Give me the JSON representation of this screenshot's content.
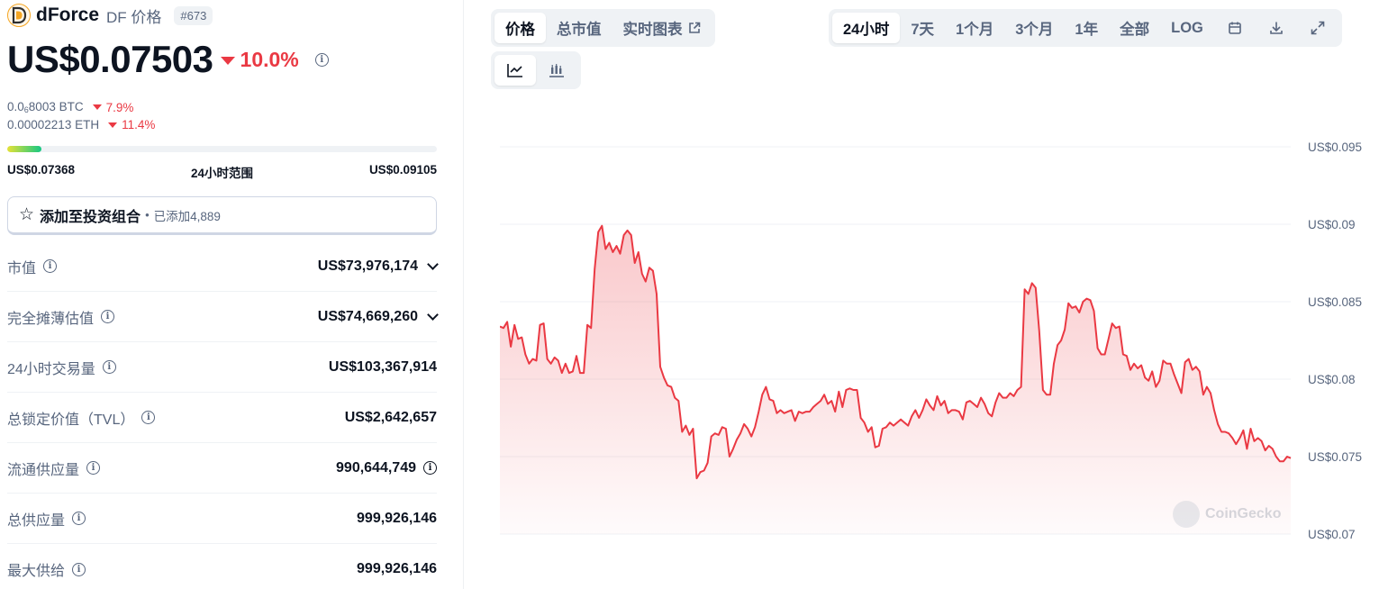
{
  "coin": {
    "name": "dForce",
    "symbol": "DF",
    "price_word": "价格",
    "rank": "#673",
    "price": "US$0.07503",
    "change_pct": "10.0%",
    "btc_price": "8003 BTC",
    "btc_change": "7.9%",
    "eth_price": "0.00002213 ETH",
    "eth_change": "11.4%"
  },
  "range": {
    "low": "US$0.07368",
    "label": "24小时范围",
    "high": "US$0.09105",
    "fill_fraction": 0.08
  },
  "portfolio": {
    "label": "添加至投资组合",
    "added": "已添加4,889"
  },
  "stats": [
    {
      "label": "市值",
      "value": "US$73,976,174",
      "icon": "info-icon",
      "expand": true
    },
    {
      "label": "完全摊薄估值",
      "value": "US$74,669,260",
      "icon": "info-icon",
      "expand": true
    },
    {
      "label": "24小时交易量",
      "value": "US$103,367,914",
      "icon": "info-icon"
    },
    {
      "label": "总锁定价值（TVL）",
      "value": "US$2,642,657",
      "icon": "info-icon"
    },
    {
      "label": "流通供应量",
      "value": "990,644,749",
      "icon": "info-icon",
      "value_info": true
    },
    {
      "label": "总供应量",
      "value": "999,926,146",
      "icon": "info-icon"
    },
    {
      "label": "最大供给",
      "value": "999,926,146",
      "icon": "info-icon"
    }
  ],
  "chart_tabs": {
    "type_tabs": [
      "价格",
      "总市值",
      "实时图表"
    ],
    "active_type": "价格",
    "style_icons": [
      "line-chart-icon",
      "candlestick-icon"
    ],
    "range_tabs": [
      "24小时",
      "7天",
      "1个月",
      "3个月",
      "1年",
      "全部",
      "LOG"
    ],
    "active_range": "24小时",
    "tool_icons": [
      "calendar-icon",
      "download-icon",
      "fullscreen-icon"
    ]
  },
  "watermark": "CoinGecko",
  "colors": {
    "line": "#ea3943",
    "fill": "#ea3943",
    "grid": "#eff2f5",
    "muted": "#58667e"
  },
  "chart_data": {
    "type": "area",
    "title": "",
    "ylim": [
      0.07,
      0.095
    ],
    "yticks": [
      0.095,
      0.09,
      0.085,
      0.08,
      0.075,
      0.07
    ],
    "ytick_labels": [
      "US$0.095",
      "US$0.09",
      "US$0.085",
      "US$0.08",
      "US$0.075",
      "US$0.07"
    ],
    "series": [
      {
        "values": [
          0.0834,
          0.0833,
          0.0837,
          0.0821,
          0.0835,
          0.0826,
          0.0827,
          0.0816,
          0.081,
          0.0813,
          0.0812,
          0.0835,
          0.0836,
          0.0813,
          0.081,
          0.0814,
          0.0812,
          0.0804,
          0.081,
          0.0804,
          0.0805,
          0.0815,
          0.0804,
          0.0804,
          0.0835,
          0.0833,
          0.0871,
          0.0895,
          0.0899,
          0.0884,
          0.0888,
          0.0882,
          0.0886,
          0.0881,
          0.0893,
          0.0896,
          0.0893,
          0.0875,
          0.0882,
          0.0868,
          0.0863,
          0.0872,
          0.087,
          0.0855,
          0.0808,
          0.0801,
          0.0796,
          0.0795,
          0.0788,
          0.0786,
          0.0766,
          0.077,
          0.0764,
          0.0768,
          0.0736,
          0.074,
          0.0741,
          0.0746,
          0.0763,
          0.0765,
          0.0764,
          0.0769,
          0.0768,
          0.075,
          0.0755,
          0.0761,
          0.0765,
          0.0771,
          0.0768,
          0.0763,
          0.0769,
          0.0779,
          0.079,
          0.0795,
          0.0787,
          0.0786,
          0.0778,
          0.078,
          0.0778,
          0.0779,
          0.078,
          0.0773,
          0.0779,
          0.0778,
          0.0779,
          0.0779,
          0.0782,
          0.0784,
          0.0786,
          0.079,
          0.0784,
          0.0786,
          0.0779,
          0.0792,
          0.0782,
          0.0793,
          0.0794,
          0.0793,
          0.0793,
          0.0775,
          0.0772,
          0.0766,
          0.0769,
          0.0756,
          0.0757,
          0.0768,
          0.0769,
          0.0772,
          0.077,
          0.0772,
          0.0774,
          0.0772,
          0.077,
          0.0776,
          0.078,
          0.0775,
          0.078,
          0.0787,
          0.0783,
          0.078,
          0.0789,
          0.0783,
          0.0786,
          0.0778,
          0.078,
          0.078,
          0.0779,
          0.0774,
          0.0785,
          0.0786,
          0.0784,
          0.0782,
          0.0788,
          0.0784,
          0.0778,
          0.0776,
          0.0785,
          0.0791,
          0.0788,
          0.0788,
          0.0791,
          0.0789,
          0.0793,
          0.0795,
          0.0858,
          0.0855,
          0.0862,
          0.0859,
          0.0831,
          0.0793,
          0.079,
          0.079,
          0.081,
          0.0822,
          0.0825,
          0.0832,
          0.0849,
          0.0846,
          0.0847,
          0.0843,
          0.085,
          0.0852,
          0.0851,
          0.0844,
          0.082,
          0.0816,
          0.0816,
          0.0826,
          0.0836,
          0.0833,
          0.0834,
          0.0816,
          0.0815,
          0.0806,
          0.081,
          0.0807,
          0.0809,
          0.0801,
          0.0799,
          0.0805,
          0.0795,
          0.0799,
          0.0812,
          0.081,
          0.081,
          0.0803,
          0.0797,
          0.0791,
          0.0811,
          0.0813,
          0.0806,
          0.0808,
          0.0805,
          0.079,
          0.0795,
          0.0791,
          0.078,
          0.0771,
          0.0766,
          0.0766,
          0.0765,
          0.0762,
          0.0758,
          0.0762,
          0.0767,
          0.0755,
          0.0768,
          0.076,
          0.0762,
          0.076,
          0.0754,
          0.0757,
          0.0755,
          0.075,
          0.0747,
          0.0747,
          0.075,
          0.0749
        ]
      }
    ]
  }
}
